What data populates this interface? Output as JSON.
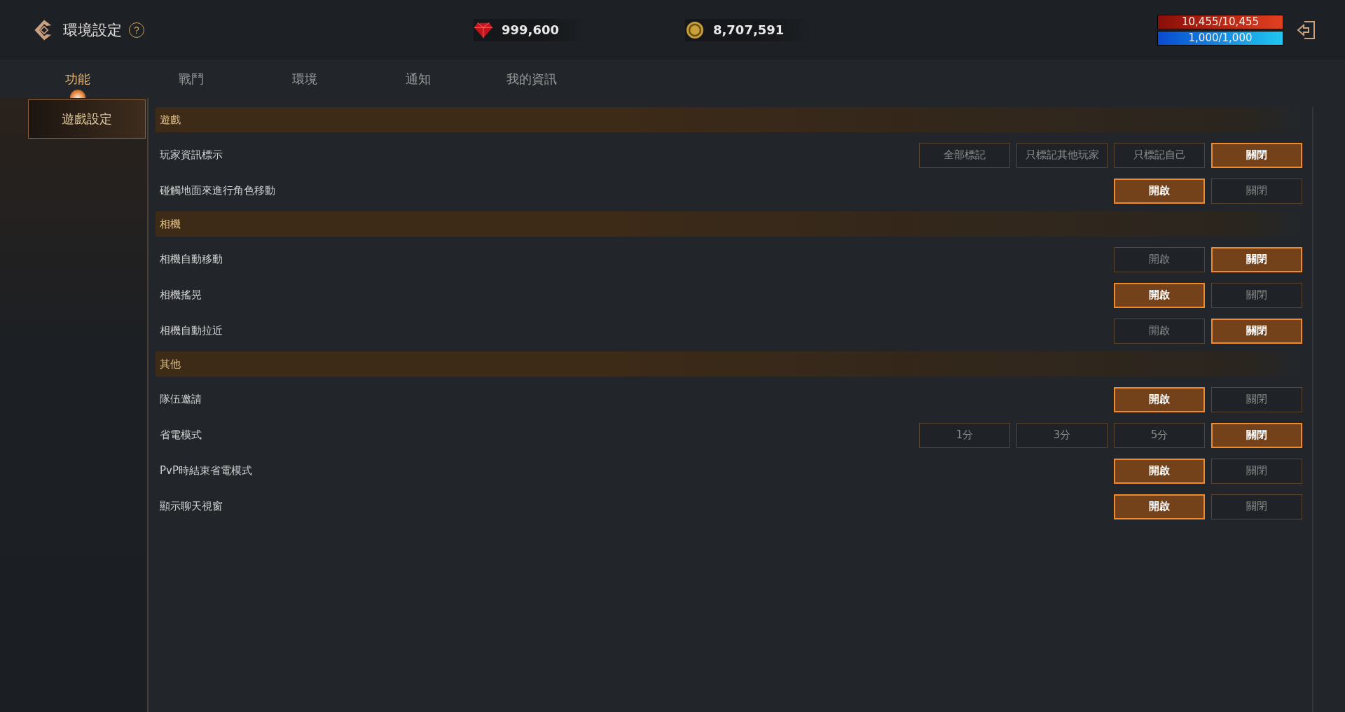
{
  "header": {
    "title": "環境設定",
    "help": "?",
    "currencies": [
      {
        "kind": "gem",
        "amount": "999,600"
      },
      {
        "kind": "coin",
        "amount": "8,707,591"
      }
    ],
    "bars": [
      {
        "kind": "hp",
        "reading": "10,455/10,455",
        "level": 1
      },
      {
        "kind": "mp",
        "reading": "1,000/1,000",
        "level": 1
      }
    ]
  },
  "tabs": [
    {
      "label": "功能",
      "selected": true
    },
    {
      "label": "戰鬥",
      "selected": false
    },
    {
      "label": "環境",
      "selected": false
    },
    {
      "label": "通知",
      "selected": false
    },
    {
      "label": "我的資訊",
      "selected": false
    }
  ],
  "sidebar": {
    "items": [
      {
        "label": "遊戲設定",
        "selected": true
      }
    ]
  },
  "sections": [
    {
      "title": "遊戲",
      "rows": [
        {
          "label": "玩家資訊標示",
          "options": [
            {
              "label": "全部標記",
              "selected": false
            },
            {
              "label": "只標記其他玩家",
              "selected": false
            },
            {
              "label": "只標記自己",
              "selected": false
            },
            {
              "label": "關閉",
              "selected": true
            }
          ]
        },
        {
          "label": "碰觸地面來進行角色移動",
          "options": [
            {
              "label": "開啟",
              "selected": true
            },
            {
              "label": "關閉",
              "selected": false
            }
          ]
        }
      ]
    },
    {
      "title": "相機",
      "rows": [
        {
          "label": "相機自動移動",
          "options": [
            {
              "label": "開啟",
              "selected": false
            },
            {
              "label": "關閉",
              "selected": true
            }
          ]
        },
        {
          "label": "相機搖晃",
          "options": [
            {
              "label": "開啟",
              "selected": true
            },
            {
              "label": "關閉",
              "selected": false
            }
          ]
        },
        {
          "label": "相機自動拉近",
          "options": [
            {
              "label": "開啟",
              "selected": false
            },
            {
              "label": "關閉",
              "selected": true
            }
          ]
        }
      ]
    },
    {
      "title": "其他",
      "rows": [
        {
          "label": "隊伍邀請",
          "options": [
            {
              "label": "開啟",
              "selected": true
            },
            {
              "label": "關閉",
              "selected": false
            }
          ]
        },
        {
          "label": "省電模式",
          "options": [
            {
              "label": "1分",
              "selected": false
            },
            {
              "label": "3分",
              "selected": false
            },
            {
              "label": "5分",
              "selected": false
            },
            {
              "label": "關閉",
              "selected": true
            }
          ]
        },
        {
          "label": "PvP時結束省電模式",
          "options": [
            {
              "label": "開啟",
              "selected": true
            },
            {
              "label": "關閉",
              "selected": false
            }
          ]
        },
        {
          "label": "顯示聊天視窗",
          "options": [
            {
              "label": "開啟",
              "selected": true
            },
            {
              "label": "關閉",
              "selected": false
            }
          ]
        }
      ]
    }
  ]
}
